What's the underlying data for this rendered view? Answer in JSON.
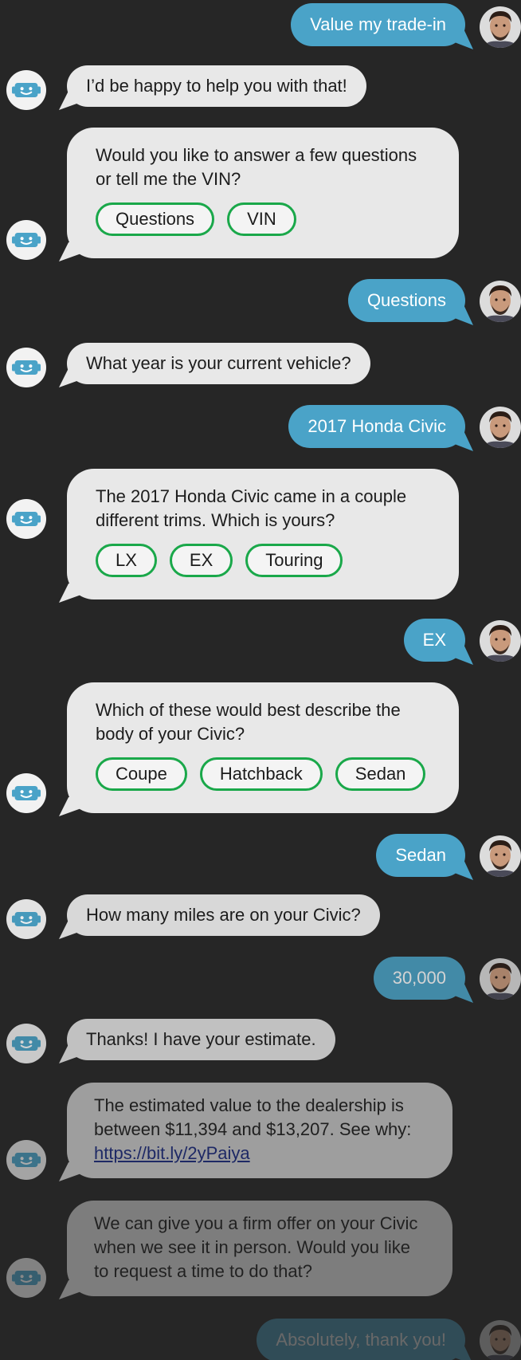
{
  "messages": {
    "m1": {
      "text": "Value my trade-in"
    },
    "m2": {
      "text": "I’d be happy to help you with that!"
    },
    "m3": {
      "line1": "Would you like to answer a few questions",
      "line2": "or tell me the VIN?",
      "options": [
        "Questions",
        "VIN"
      ]
    },
    "m4": {
      "text": "Questions"
    },
    "m5": {
      "text": "What year is your current vehicle?"
    },
    "m6": {
      "text": "2017 Honda Civic"
    },
    "m7": {
      "line1": "The 2017 Honda Civic came in a couple",
      "line2": "different trims. Which is yours?",
      "options": [
        "LX",
        "EX",
        "Touring"
      ]
    },
    "m8": {
      "text": "EX"
    },
    "m9": {
      "line1": "Which of these would best describe the",
      "line2": "body of your Civic?",
      "options": [
        "Coupe",
        "Hatchback",
        "Sedan"
      ]
    },
    "m10": {
      "text": "Sedan"
    },
    "m11": {
      "text": "How many miles are on your Civic?"
    },
    "m12": {
      "text": "30,000"
    },
    "m13": {
      "text": "Thanks! I have your estimate."
    },
    "m14": {
      "line1": "The estimated value to the dealership is",
      "line2": "between $11,394 and $13,207. See why:",
      "link": "https://bit.ly/2yPaiya"
    },
    "m15": {
      "line1": "We can give you a firm offer on your Civic",
      "line2": "when we see it in person. Would you like",
      "line3": "to request a time to do that?"
    },
    "m16": {
      "text": "Absolutely, thank you!"
    }
  },
  "colors": {
    "background": "#262626",
    "user_bubble": "#4aa3c8",
    "bot_bubble": "#e8e8e8",
    "option_border": "#1aa84a",
    "bot_icon": "#4aa3c8"
  },
  "icons": {
    "bot_avatar": "robot-face-icon",
    "user_avatar": "user-photo-avatar"
  }
}
